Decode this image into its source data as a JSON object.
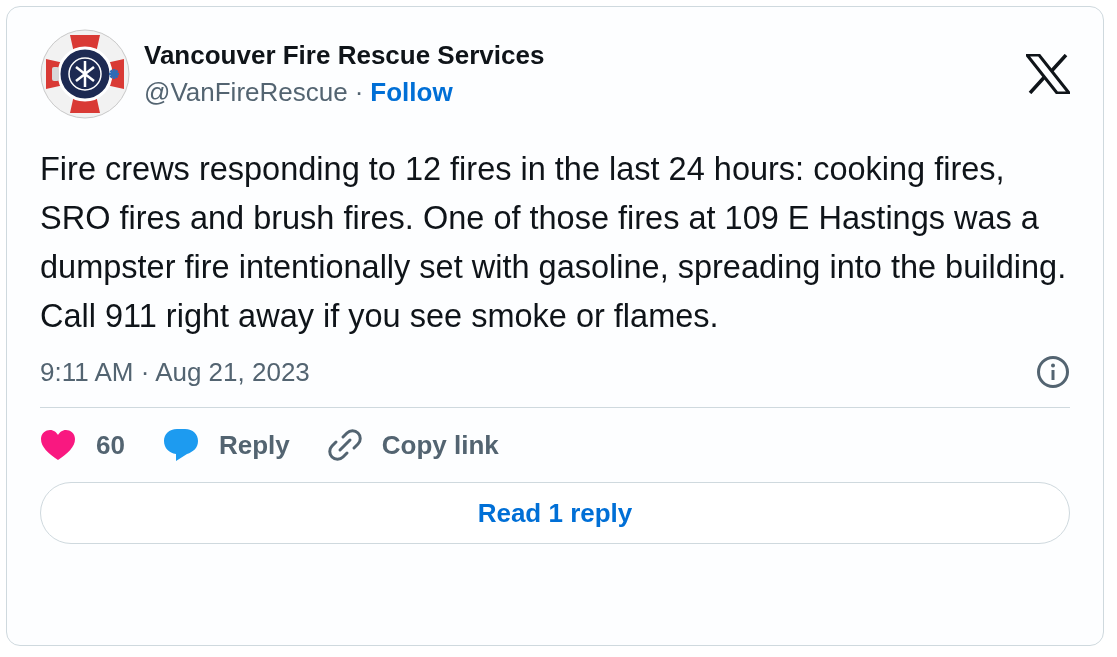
{
  "author": {
    "name": "Vancouver Fire Rescue Services",
    "handle": "@VanFireRescue",
    "separator": "·",
    "follow": "Follow"
  },
  "text": "Fire crews responding to 12 fires in the last 24 hours: cooking fires, SRO fires and brush fires. One of those fires at 109 E Hastings was a dumpster fire intentionally set with gasoline, spreading into the building. Call 911 right away if you see smoke or flames.",
  "timestamp": "9:11 AM · Aug 21, 2023",
  "actions": [
    {
      "kind": "like",
      "label": "60"
    },
    {
      "kind": "reply",
      "label": "Reply"
    },
    {
      "kind": "copy",
      "label": "Copy link"
    }
  ],
  "read_replies": "Read 1 reply"
}
